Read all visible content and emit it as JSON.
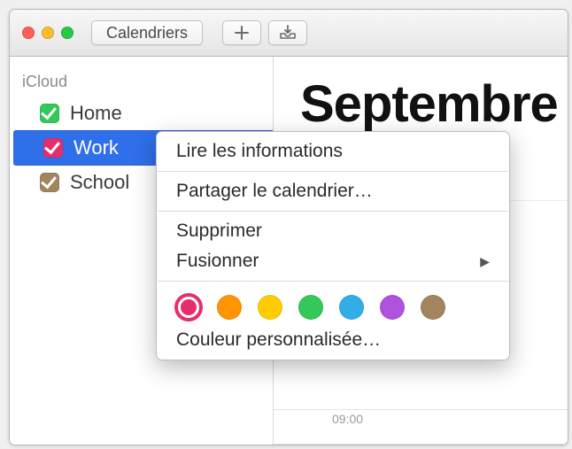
{
  "toolbar": {
    "calendars_label": "Calendriers"
  },
  "sidebar": {
    "section": "iCloud",
    "items": [
      {
        "label": "Home",
        "color": "#34c759"
      },
      {
        "label": "Work",
        "color": "#e62e6b"
      },
      {
        "label": "School",
        "color": "#a2845e"
      }
    ]
  },
  "main": {
    "month_title": "Septembre",
    "time_label": "09:00"
  },
  "context_menu": {
    "get_info": "Lire les informations",
    "share": "Partager le calendrier…",
    "delete": "Supprimer",
    "merge": "Fusionner",
    "custom_color": "Couleur personnalisée…",
    "colors": [
      "#e62e6b",
      "#ff9500",
      "#ffcc00",
      "#34c759",
      "#32ade6",
      "#af52de",
      "#a2845e"
    ],
    "selected_color_index": 0
  }
}
